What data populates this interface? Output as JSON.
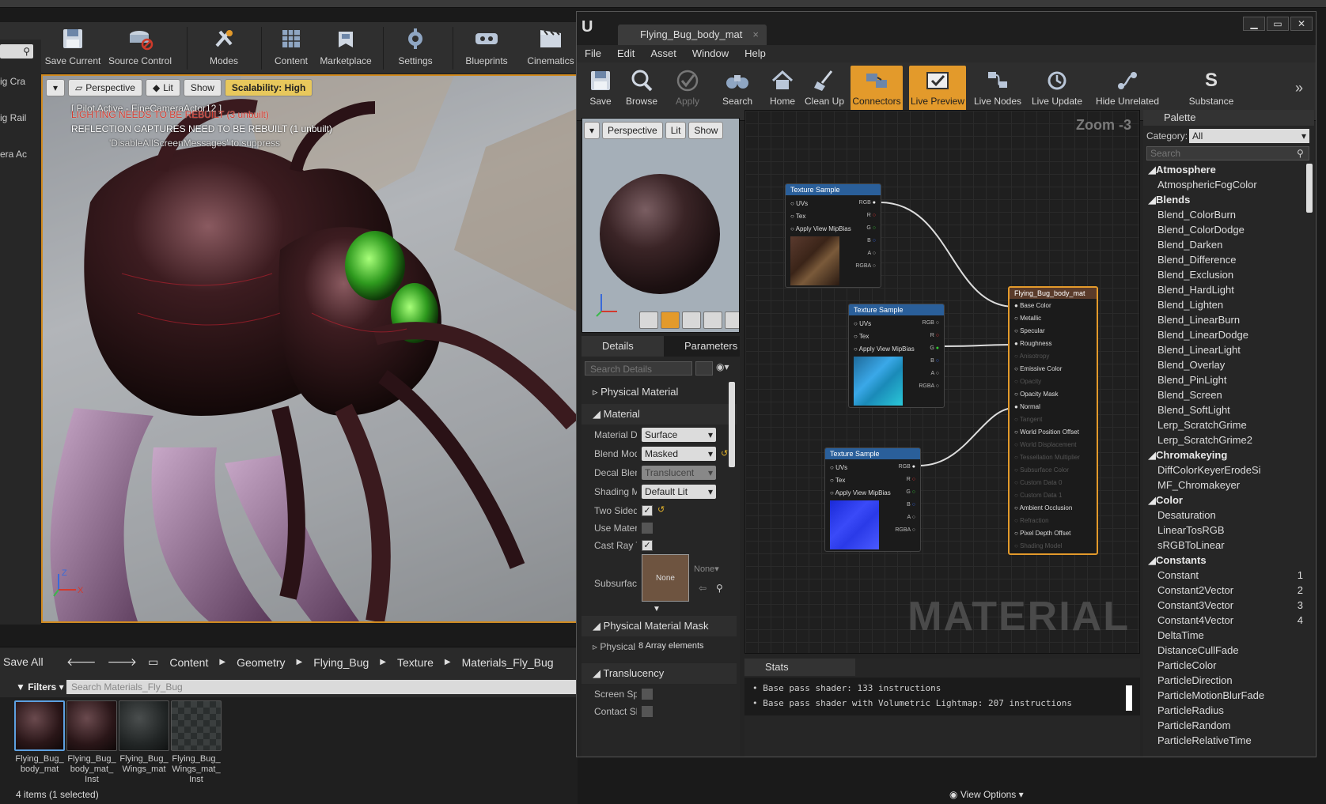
{
  "main": {
    "toolbar": [
      {
        "label": "Save Current",
        "icon": "floppy-icon"
      },
      {
        "label": "Source Control",
        "icon": "source-control-icon"
      },
      {
        "label": "Modes",
        "icon": "modes-icon"
      },
      {
        "label": "Content",
        "icon": "content-icon"
      },
      {
        "label": "Marketplace",
        "icon": "marketplace-icon"
      },
      {
        "label": "Settings",
        "icon": "settings-icon"
      },
      {
        "label": "Blueprints",
        "icon": "blueprints-icon"
      },
      {
        "label": "Cinematics",
        "icon": "cinematics-icon"
      }
    ],
    "left_rows": [
      "ig Cra",
      "ig Rail",
      "era Ac"
    ],
    "viewport": {
      "perspective": "Perspective",
      "lit": "Lit",
      "show": "Show",
      "scalability": "Scalability: High",
      "pilot_msg": "[ Pilot Active - FineCameraActor12 ]",
      "lighting_msg": "LIGHTING NEEDS TO BE REBUILT (3 unbuilt)",
      "reflection_msg": "REFLECTION CAPTURES NEED TO BE REBUILT (1 unbuilt)",
      "disable_msg": "'DisableAllScreenMessages' to suppress"
    },
    "content_browser": {
      "save_all": "Save All",
      "crumbs": [
        "Content",
        "Geometry",
        "Flying_Bug",
        "Texture",
        "Materials_Fly_Bug"
      ],
      "filters": "Filters",
      "search_placeholder": "Search Materials_Fly_Bug",
      "assets": [
        {
          "name": "Flying_Bug_ body_mat",
          "color": "#3a2426"
        },
        {
          "name": "Flying_Bug_ body_mat_ Inst",
          "color": "#3a2426"
        },
        {
          "name": "Flying_Bug_ Wings_mat",
          "color": "#2b2f2f"
        },
        {
          "name": "Flying_Bug_ Wings_mat_ Inst",
          "color": "#3b3f3f"
        }
      ],
      "status": "4 items (1 selected)",
      "view_options": "View Options"
    }
  },
  "material_editor": {
    "tab_title": "Flying_Bug_body_mat",
    "menu": [
      "File",
      "Edit",
      "Asset",
      "Window",
      "Help"
    ],
    "toolbar": [
      {
        "label": "Save",
        "icon": "floppy-icon",
        "state": "normal"
      },
      {
        "label": "Browse",
        "icon": "magnifier-icon",
        "state": "normal"
      },
      {
        "label": "Apply",
        "icon": "checkmark-icon",
        "state": "disabled"
      },
      {
        "label": "Search",
        "icon": "binoculars-icon",
        "state": "normal"
      },
      {
        "label": "Home",
        "icon": "home-icon",
        "state": "normal"
      },
      {
        "label": "Clean Up",
        "icon": "broom-icon",
        "state": "normal"
      },
      {
        "label": "Connectors",
        "icon": "connectors-icon",
        "state": "active"
      },
      {
        "label": "Live Preview",
        "icon": "live-preview-icon",
        "state": "active"
      },
      {
        "label": "Live Nodes",
        "icon": "live-nodes-icon",
        "state": "normal"
      },
      {
        "label": "Live Update",
        "icon": "live-update-icon",
        "state": "normal"
      },
      {
        "label": "Hide Unrelated",
        "icon": "hide-unrelated-icon",
        "state": "normal"
      },
      {
        "label": "Substance",
        "icon": "substance-icon",
        "state": "normal"
      }
    ],
    "preview": {
      "perspective": "Perspective",
      "lit": "Lit",
      "show": "Show"
    },
    "details": {
      "tab_details": "Details",
      "tab_params": "Parameters",
      "search_placeholder": "Search Details",
      "sections": {
        "physical_material": "Physical Material",
        "material": "Material",
        "physical_material_mask": "Physical Material Mask",
        "translucency": "Translucency"
      },
      "props": [
        {
          "label": "Material Domain",
          "value": "Surface"
        },
        {
          "label": "Blend Mode",
          "value": "Masked"
        },
        {
          "label": "Decal Blend Mode",
          "value": "Translucent"
        },
        {
          "label": "Shading Model",
          "value": "Default Lit"
        }
      ],
      "checks": [
        {
          "label": "Two Sided",
          "checked": true
        },
        {
          "label": "Use Material Attributes",
          "checked": false
        },
        {
          "label": "Cast Ray Traced Shadows",
          "checked": true
        }
      ],
      "subsurface_label": "Subsurface Profile",
      "subsurface_value": "None",
      "subsurface_dropdown": "None",
      "phys_mask_label": "Physical Material Map",
      "phys_mask_value": "8 Array elements",
      "trans_checks": [
        {
          "label": "Screen Space Reflections",
          "checked": false
        },
        {
          "label": "Contact Shadows",
          "checked": false
        }
      ]
    },
    "graph": {
      "zoom": "Zoom -3",
      "watermark": "MATERIAL",
      "tex_node_title": "Texture Sample",
      "tex_pins_left": [
        "UVs",
        "Tex",
        "Apply View MipBias"
      ],
      "tex_pins_right": [
        "RGB",
        "R",
        "G",
        "B",
        "A",
        "RGBA"
      ],
      "result_title": "Flying_Bug_body_mat",
      "result_pins": [
        {
          "label": "Base Color",
          "active": true
        },
        {
          "label": "Metallic",
          "active": true
        },
        {
          "label": "Specular",
          "active": true
        },
        {
          "label": "Roughness",
          "active": true
        },
        {
          "label": "Anisotropy",
          "active": false
        },
        {
          "label": "Emissive Color",
          "active": true
        },
        {
          "label": "Opacity",
          "active": false
        },
        {
          "label": "Opacity Mask",
          "active": true
        },
        {
          "label": "Normal",
          "active": true
        },
        {
          "label": "Tangent",
          "active": false
        },
        {
          "label": "World Position Offset",
          "active": true
        },
        {
          "label": "World Displacement",
          "active": false
        },
        {
          "label": "Tessellation Multiplier",
          "active": false
        },
        {
          "label": "Subsurface Color",
          "active": false
        },
        {
          "label": "Custom Data 0",
          "active": false
        },
        {
          "label": "Custom Data 1",
          "active": false
        },
        {
          "label": "Ambient Occlusion",
          "active": true
        },
        {
          "label": "Refraction",
          "active": false
        },
        {
          "label": "Pixel Depth Offset",
          "active": true
        },
        {
          "label": "Shading Model",
          "active": false
        }
      ]
    },
    "stats": {
      "tab": "Stats",
      "lines": [
        "Base pass shader: 133 instructions",
        "Base pass shader with Volumetric Lightmap: 207 instructions"
      ]
    },
    "palette": {
      "title": "Palette",
      "category_label": "Category:",
      "category_value": "All",
      "search_placeholder": "Search",
      "items": [
        {
          "label": "Atmosphere",
          "cat": true
        },
        {
          "label": "AtmosphericFogColor"
        },
        {
          "label": "Blends",
          "cat": true
        },
        {
          "label": "Blend_ColorBurn"
        },
        {
          "label": "Blend_ColorDodge"
        },
        {
          "label": "Blend_Darken"
        },
        {
          "label": "Blend_Difference"
        },
        {
          "label": "Blend_Exclusion"
        },
        {
          "label": "Blend_HardLight"
        },
        {
          "label": "Blend_Lighten"
        },
        {
          "label": "Blend_LinearBurn"
        },
        {
          "label": "Blend_LinearDodge"
        },
        {
          "label": "Blend_LinearLight"
        },
        {
          "label": "Blend_Overlay"
        },
        {
          "label": "Blend_PinLight"
        },
        {
          "label": "Blend_Screen"
        },
        {
          "label": "Blend_SoftLight"
        },
        {
          "label": "Lerp_ScratchGrime"
        },
        {
          "label": "Lerp_ScratchGrime2"
        },
        {
          "label": "Chromakeying",
          "cat": true
        },
        {
          "label": "DiffColorKeyerErodeSi"
        },
        {
          "label": "MF_Chromakeyer"
        },
        {
          "label": "Color",
          "cat": true
        },
        {
          "label": "Desaturation"
        },
        {
          "label": "LinearTosRGB"
        },
        {
          "label": "sRGBToLinear"
        },
        {
          "label": "Constants",
          "cat": true
        },
        {
          "label": "Constant",
          "key": "1"
        },
        {
          "label": "Constant2Vector",
          "key": "2"
        },
        {
          "label": "Constant3Vector",
          "key": "3"
        },
        {
          "label": "Constant4Vector",
          "key": "4"
        },
        {
          "label": "DeltaTime"
        },
        {
          "label": "DistanceCullFade"
        },
        {
          "label": "ParticleColor"
        },
        {
          "label": "ParticleDirection"
        },
        {
          "label": "ParticleMotionBlurFade"
        },
        {
          "label": "ParticleRadius"
        },
        {
          "label": "ParticleRandom"
        },
        {
          "label": "ParticleRelativeTime"
        }
      ]
    }
  }
}
